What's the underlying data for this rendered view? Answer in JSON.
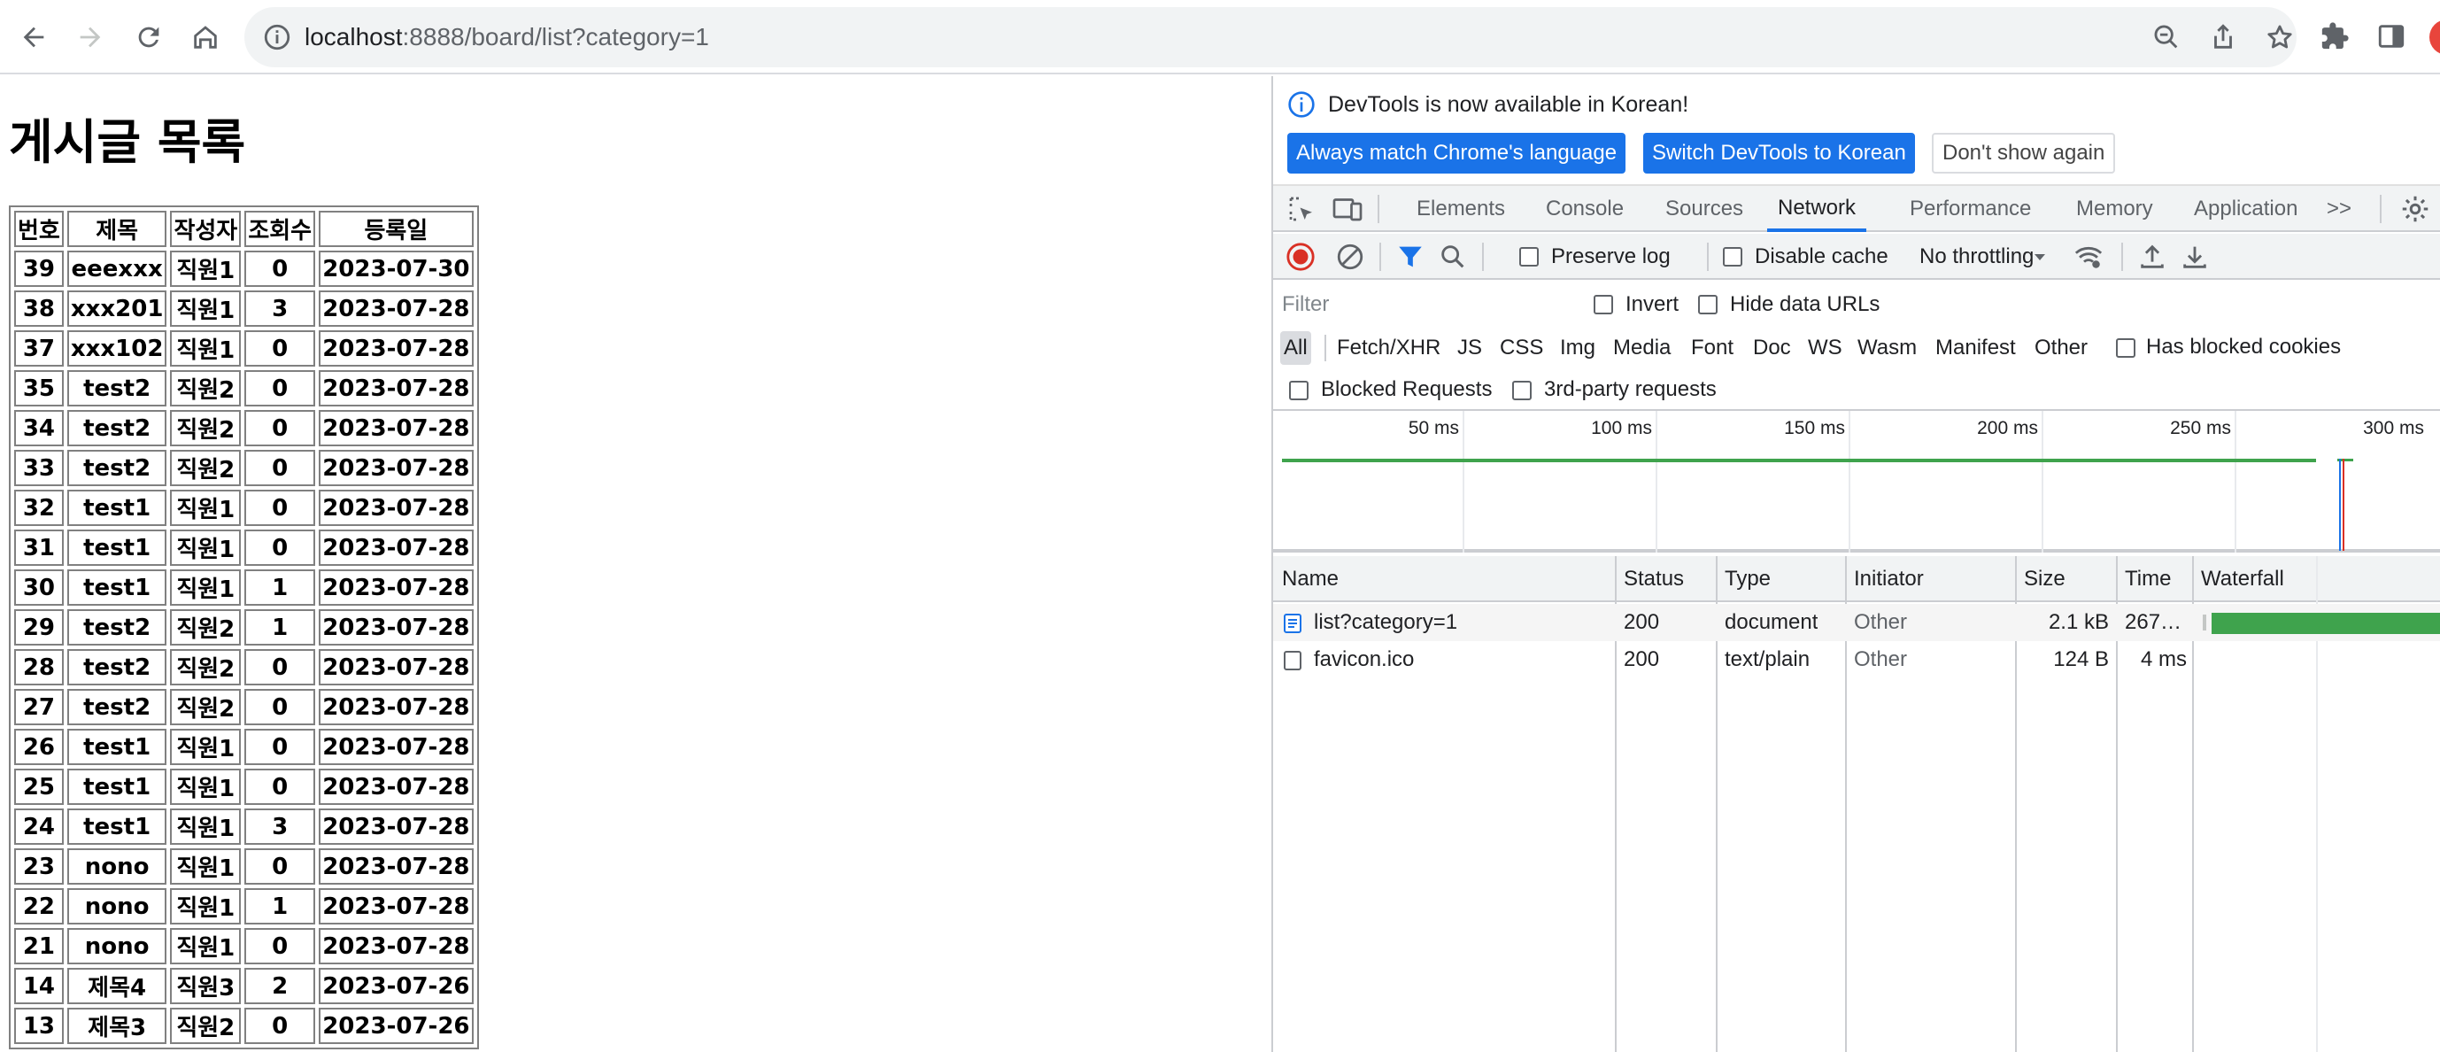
{
  "browser": {
    "url_host": "localhost",
    "url_path": ":8888/board/list?category=1"
  },
  "page": {
    "title": "게시글 목록",
    "table": {
      "headers": [
        "번호",
        "제목",
        "작성자",
        "조회수",
        "등록일"
      ],
      "rows": [
        [
          "39",
          "eeexxx",
          "직원1",
          "0",
          "2023-07-30"
        ],
        [
          "38",
          "xxx201",
          "직원1",
          "3",
          "2023-07-28"
        ],
        [
          "37",
          "xxx102",
          "직원1",
          "0",
          "2023-07-28"
        ],
        [
          "35",
          "test2",
          "직원2",
          "0",
          "2023-07-28"
        ],
        [
          "34",
          "test2",
          "직원2",
          "0",
          "2023-07-28"
        ],
        [
          "33",
          "test2",
          "직원2",
          "0",
          "2023-07-28"
        ],
        [
          "32",
          "test1",
          "직원1",
          "0",
          "2023-07-28"
        ],
        [
          "31",
          "test1",
          "직원1",
          "0",
          "2023-07-28"
        ],
        [
          "30",
          "test1",
          "직원1",
          "1",
          "2023-07-28"
        ],
        [
          "29",
          "test2",
          "직원2",
          "1",
          "2023-07-28"
        ],
        [
          "28",
          "test2",
          "직원2",
          "0",
          "2023-07-28"
        ],
        [
          "27",
          "test2",
          "직원2",
          "0",
          "2023-07-28"
        ],
        [
          "26",
          "test1",
          "직원1",
          "0",
          "2023-07-28"
        ],
        [
          "25",
          "test1",
          "직원1",
          "0",
          "2023-07-28"
        ],
        [
          "24",
          "test1",
          "직원1",
          "3",
          "2023-07-28"
        ],
        [
          "23",
          "nono",
          "직원1",
          "0",
          "2023-07-28"
        ],
        [
          "22",
          "nono",
          "직원1",
          "1",
          "2023-07-28"
        ],
        [
          "21",
          "nono",
          "직원1",
          "0",
          "2023-07-28"
        ],
        [
          "14",
          "제목4",
          "직원3",
          "2",
          "2023-07-26"
        ],
        [
          "13",
          "제목3",
          "직원2",
          "0",
          "2023-07-26"
        ]
      ]
    }
  },
  "devtools": {
    "infobar": {
      "message": "DevTools is now available in Korean!",
      "btn_match": "Always match Chrome's language",
      "btn_switch": "Switch DevTools to Korean",
      "btn_dismiss": "Don't show again"
    },
    "tabs": [
      "Elements",
      "Console",
      "Sources",
      "Network",
      "Performance",
      "Memory",
      "Application"
    ],
    "active_tab": "Network",
    "more_tabs": ">>",
    "controls": {
      "preserve_log": "Preserve log",
      "disable_cache": "Disable cache",
      "throttling": "No throttling"
    },
    "filter": {
      "placeholder": "Filter",
      "invert": "Invert",
      "hide_data_urls": "Hide data URLs",
      "types": [
        "All",
        "Fetch/XHR",
        "JS",
        "CSS",
        "Img",
        "Media",
        "Font",
        "Doc",
        "WS",
        "Wasm",
        "Manifest",
        "Other"
      ],
      "has_blocked_cookies": "Has blocked cookies",
      "blocked_requests": "Blocked Requests",
      "third_party": "3rd-party requests"
    },
    "overview": {
      "ticks": [
        "50 ms",
        "100 ms",
        "150 ms",
        "200 ms",
        "250 ms",
        "300 ms"
      ]
    },
    "network_table": {
      "headers": [
        "Name",
        "Status",
        "Type",
        "Initiator",
        "Size",
        "Time",
        "Waterfall"
      ],
      "rows": [
        {
          "name": "list?category=1",
          "status": "200",
          "type": "document",
          "initiator": "Other",
          "size": "2.1 kB",
          "time": "267…"
        },
        {
          "name": "favicon.ico",
          "status": "200",
          "type": "text/plain",
          "initiator": "Other",
          "size": "124 B",
          "time": "4 ms"
        }
      ]
    },
    "colors": {
      "accent": "#1a73e8",
      "waterfall_green": "#3fa34d",
      "record_red": "#d93025"
    }
  }
}
